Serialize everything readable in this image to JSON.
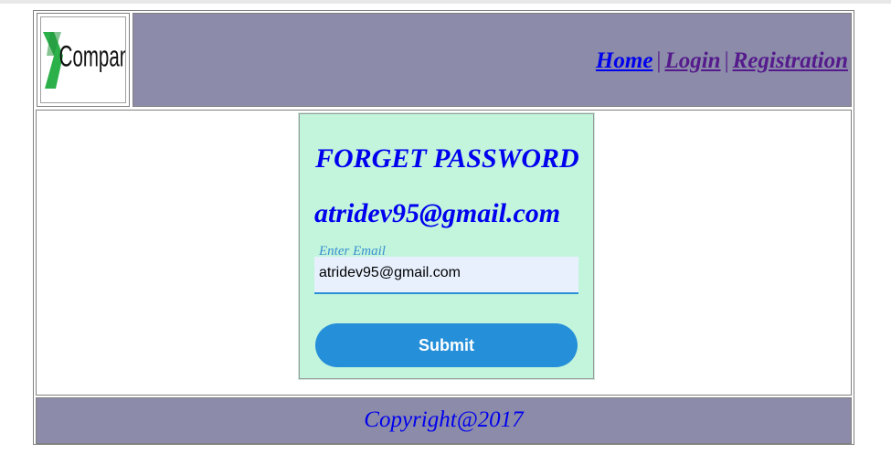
{
  "header": {
    "logo": {
      "text": "Company",
      "mark": "X",
      "mark_color": "#2bb04a"
    },
    "nav": {
      "home": "Home",
      "separator": "|",
      "login": "Login",
      "registration": "Registration"
    },
    "background_color": "#8c8caa"
  },
  "form": {
    "title": "FORGET PASSWORD",
    "email_heading": "atridev95@gmail.com",
    "email_label": "Enter Email",
    "email_value": "atridev95@gmail.com",
    "submit_label": "Submit",
    "card_color": "#c2f5dc",
    "button_color": "#258fd9"
  },
  "footer": {
    "copyright": "Copyright@2017"
  }
}
